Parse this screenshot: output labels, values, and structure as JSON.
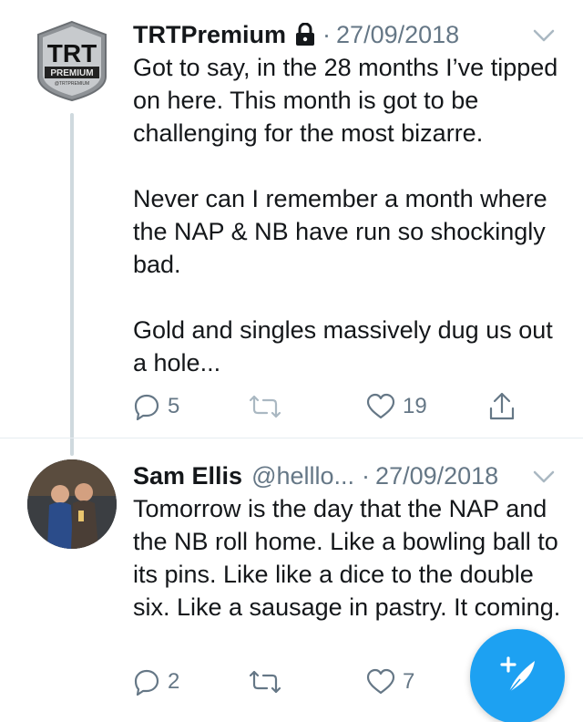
{
  "tweets": [
    {
      "name": "TRTPremium",
      "handle": "",
      "date": "27/09/2018",
      "protected": true,
      "avatar": {
        "logo_top": "TRT",
        "logo_bottom": "PREMIUM",
        "logo_small": "@TRTPREMIUM"
      },
      "paragraphs": [
        "Got to say, in the 28 months I’ve tipped on here. This month is got to be challenging for the most bizarre.",
        "Never can I remember a month where the NAP & NB have run so shockingly bad.",
        "Gold and singles massively dug us out a hole..."
      ],
      "replies": "5",
      "retweets": "",
      "likes": "19"
    },
    {
      "name": "Sam Ellis",
      "handle": "@helllo...",
      "date": "27/09/2018",
      "protected": false,
      "paragraphs": [
        "Tomorrow is the day that the NAP and the NB roll home. Like a bowling ball to its pins. Like like a dice to the double six. Like a sausage in pastry. It coming."
      ],
      "replies": "2",
      "retweets": "",
      "likes": "7"
    }
  ],
  "separator": "·",
  "colors": {
    "text": "#14171a",
    "secondary": "#657786",
    "accent": "#1da1f2",
    "thread": "#cfd9de"
  },
  "icons": [
    "lock-icon",
    "chevron-down-icon",
    "reply-icon",
    "retweet-icon",
    "like-icon",
    "share-icon",
    "compose-icon"
  ]
}
